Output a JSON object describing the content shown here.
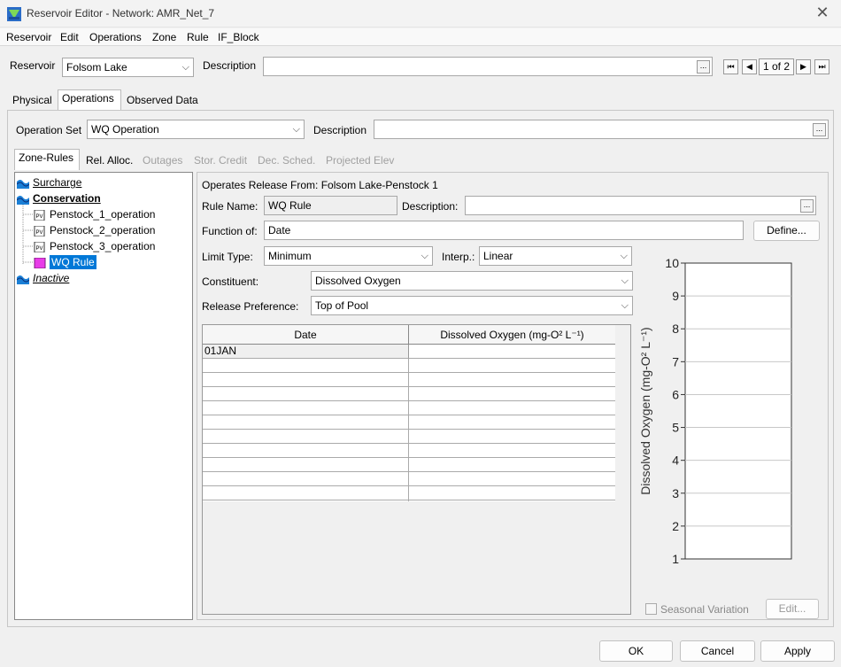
{
  "window": {
    "title": "Reservoir Editor - Network: AMR_Net_7"
  },
  "menu": [
    "Reservoir",
    "Edit",
    "Operations",
    "Zone",
    "Rule",
    "IF_Block"
  ],
  "reservoir": {
    "label": "Reservoir",
    "value": "Folsom Lake",
    "description_label": "Description",
    "description_value": "",
    "page": "1 of 2"
  },
  "main_tabs": [
    "Physical",
    "Operations",
    "Observed Data"
  ],
  "operation_set": {
    "label": "Operation Set",
    "value": "WQ Operation",
    "description_label": "Description",
    "description_value": ""
  },
  "sub_tabs": [
    "Zone-Rules",
    "Rel. Alloc.",
    "Outages",
    "Stor. Credit",
    "Dec. Sched.",
    "Projected Elev"
  ],
  "tree": {
    "surcharge": "Surcharge",
    "conservation": "Conservation",
    "penstock1": "Penstock_1_operation",
    "penstock2": "Penstock_2_operation",
    "penstock3": "Penstock_3_operation",
    "wq_rule": "WQ Rule",
    "inactive": "Inactive"
  },
  "rule": {
    "operates_from": "Operates Release From: Folsom Lake-Penstock 1",
    "name_label": "Rule Name:",
    "name_value": "WQ Rule",
    "desc_label": "Description:",
    "desc_value": "",
    "function_label": "Function of:",
    "function_value": "Date",
    "define_label": "Define...",
    "limit_label": "Limit Type:",
    "limit_value": "Minimum",
    "interp_label": "Interp.:",
    "interp_value": "Linear",
    "constituent_label": "Constituent:",
    "constituent_value": "Dissolved Oxygen",
    "pref_label": "Release Preference:",
    "pref_value": "Top of Pool"
  },
  "table": {
    "headers": [
      "Date",
      "Dissolved Oxygen (mg-O² L⁻¹)"
    ],
    "rows": [
      [
        "01JAN",
        ""
      ]
    ]
  },
  "chart_data": {
    "type": "line",
    "title": "",
    "xlabel": "",
    "ylabel": "Dissolved Oxygen (mg-O² L⁻¹)",
    "ylim": [
      1,
      10
    ],
    "yticks": [
      1,
      2,
      3,
      4,
      5,
      6,
      7,
      8,
      9,
      10
    ],
    "grid": true,
    "series": []
  },
  "seasonal": {
    "label": "Seasonal Variation",
    "checked": false,
    "edit_label": "Edit..."
  },
  "buttons": {
    "ok": "OK",
    "cancel": "Cancel",
    "apply": "Apply"
  }
}
